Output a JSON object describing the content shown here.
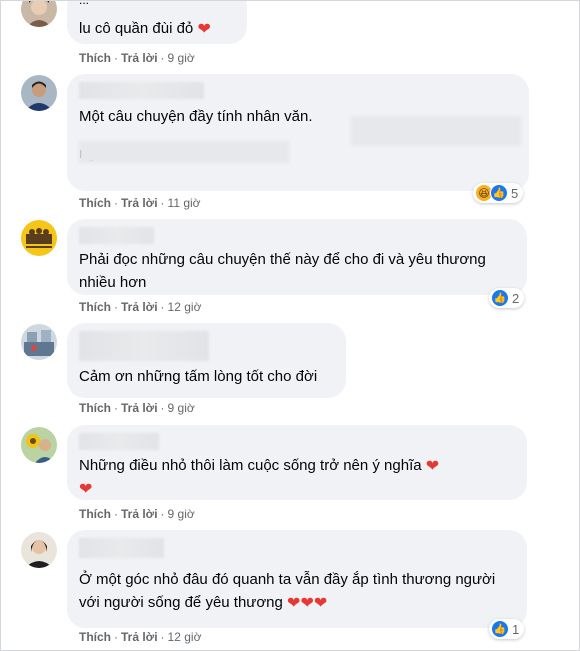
{
  "comments": [
    {
      "name_partial": "...",
      "text": "lu cô quần đùi đỏ",
      "like": "Thích",
      "reply": "Trả lời",
      "time": "9 giờ"
    },
    {
      "text_line1": "Một câu chuyện đầy tính nhân văn.",
      "text_line2": "ngẫm!",
      "like": "Thích",
      "reply": "Trả lời",
      "time": "11 giờ",
      "reaction_count": "5"
    },
    {
      "text": "Phải đọc những câu chuyện thế này để cho đi và yêu thương nhiều hơn",
      "like": "Thích",
      "reply": "Trả lời",
      "time": "12 giờ",
      "reaction_count": "2"
    },
    {
      "text": "Cảm ơn những tấm lòng tốt cho đời",
      "like": "Thích",
      "reply": "Trả lời",
      "time": "9 giờ"
    },
    {
      "text": "Những điều nhỏ thôi làm cuộc sống trở nên ý nghĩa",
      "like": "Thích",
      "reply": "Trả lời",
      "time": "9 giờ"
    },
    {
      "text": "Ở một góc nhỏ đâu đó quanh ta vẫn đầy ắp tình thương người với người sống để yêu thương",
      "like": "Thích",
      "reply": "Trả lời",
      "time": "12 giờ",
      "reaction_count": "1"
    }
  ],
  "icons": {
    "heart": "heart-icon",
    "like": "like-reaction-icon",
    "haha": "haha-reaction-icon"
  },
  "colors": {
    "bubble": "#f0f2f5",
    "action_text": "#65676b",
    "like_blue": "#1877f2",
    "heart_red": "#e53935"
  }
}
